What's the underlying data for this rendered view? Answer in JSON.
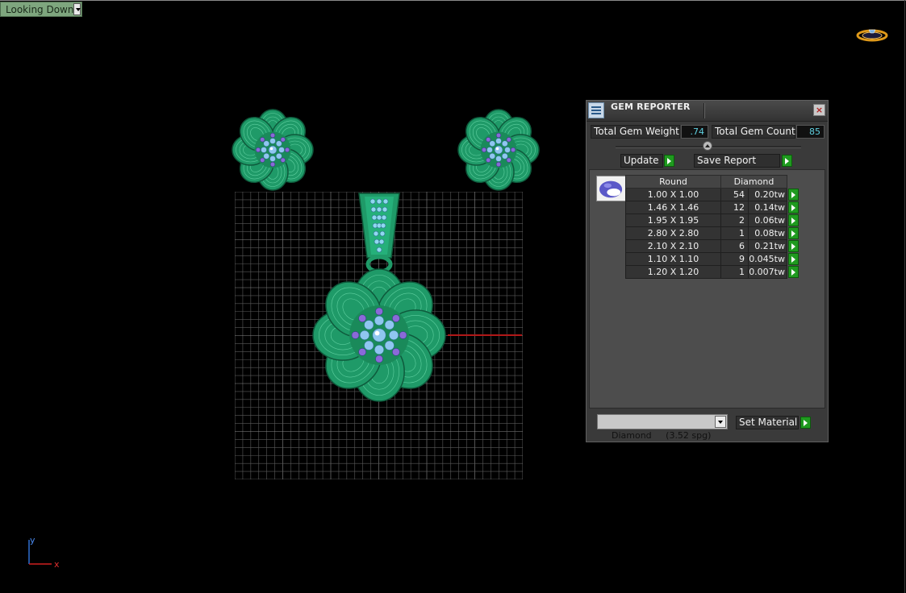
{
  "viewport": {
    "view_label": "Looking Down",
    "axis_x": "x",
    "axis_y": "y"
  },
  "gem_reporter": {
    "title": "GEM REPORTER",
    "close": "×",
    "total_weight_label": "Total Gem Weight",
    "total_weight_value": ".74",
    "total_count_label": "Total Gem Count",
    "total_count_value": "85",
    "update_label": "Update",
    "save_report_label": "Save Report",
    "table": {
      "col_size": "Round",
      "col_material": "Diamond",
      "rows": [
        {
          "size": "1.00 X 1.00",
          "count": "54",
          "weight": "0.20tw"
        },
        {
          "size": "1.46 X 1.46",
          "count": "12",
          "weight": "0.14tw"
        },
        {
          "size": "1.95 X 1.95",
          "count": "2",
          "weight": "0.06tw"
        },
        {
          "size": "2.80 X 2.80",
          "count": "1",
          "weight": "0.08tw"
        },
        {
          "size": "2.10 X 2.10",
          "count": "6",
          "weight": "0.21tw"
        },
        {
          "size": "1.10 X 1.10",
          "count": "9",
          "weight": "0.045tw"
        },
        {
          "size": "1.20 X 1.20",
          "count": "1",
          "weight": "0.007tw"
        }
      ]
    },
    "material_select": "Diamond     (3.52 spg)",
    "set_material_label": "Set Material"
  },
  "colors": {
    "metal": "#1f9a68",
    "gem": "#8fc6f0",
    "amethyst": "#8a6ad8",
    "grid": "#5a5a5a"
  }
}
